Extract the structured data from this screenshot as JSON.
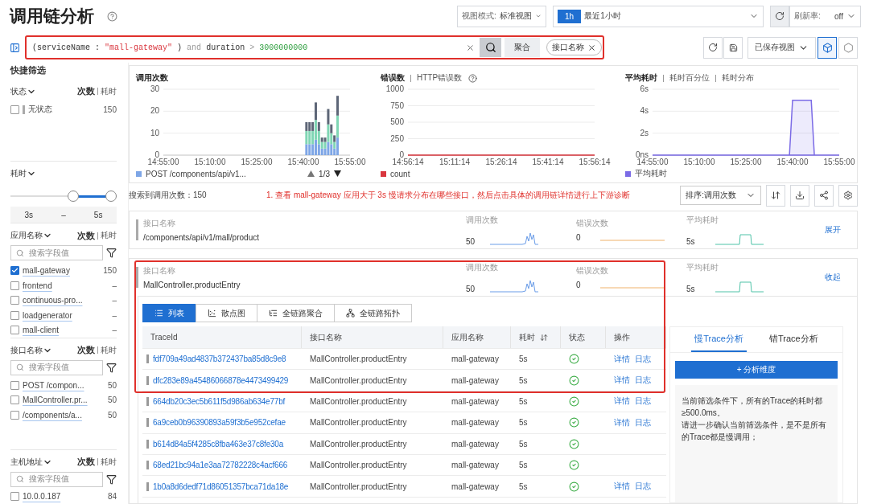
{
  "page": {
    "title": "调用链分析"
  },
  "toolbar": {
    "view_mode": {
      "label": "视图模式:",
      "value": "标准视图"
    },
    "time_range": {
      "badge": "1h",
      "value": "最近1小时"
    },
    "refresh_rate": {
      "label": "刷新率:",
      "value": "off"
    }
  },
  "query": {
    "highlighted": true,
    "tokens": [
      {
        "text": "(serviceName :",
        "kind": "plain"
      },
      {
        "text": "\"mall-gateway\"",
        "kind": "string"
      },
      {
        "text": ")",
        "kind": "plain"
      },
      {
        "text": "and",
        "kind": "keyword"
      },
      {
        "text": "duration",
        "kind": "plain"
      },
      {
        "text": ">",
        "kind": "keyword"
      },
      {
        "text": "3000000000",
        "kind": "number"
      }
    ],
    "group_label": "聚合",
    "group_tags": [
      "接口名称"
    ]
  },
  "saved_views": {
    "label": "已保存视图"
  },
  "view_toggle": [
    {
      "selected": true
    },
    {
      "selected": false
    }
  ],
  "sidebar": {
    "title": "快捷筛选",
    "sections": [
      {
        "kind": "status",
        "title": "状态",
        "metric_tabs": [
          {
            "label": "次数",
            "selected": true
          },
          {
            "label": "耗时",
            "selected": false
          }
        ],
        "items": [
          {
            "label": "无状态",
            "count": "150",
            "checked": false
          }
        ]
      },
      {
        "kind": "range",
        "title": "耗时",
        "labels": [
          "3s",
          "–",
          "5s"
        ],
        "thumbs": [
          {
            "level": 0.6
          },
          {
            "level": 1
          }
        ]
      },
      {
        "kind": "search",
        "title": "应用名称",
        "metric_tabs": [
          {
            "label": "次数",
            "selected": true
          },
          {
            "label": "耗时",
            "selected": false
          }
        ],
        "placeholder": "搜索字段值",
        "items": [
          {
            "label": "mall-gateway",
            "count": "150",
            "checked": true
          },
          {
            "label": "frontend",
            "count": "–",
            "checked": false
          },
          {
            "label": "continuous-pro...",
            "count": "–",
            "checked": false
          },
          {
            "label": "loadgenerator",
            "count": "–",
            "checked": false
          },
          {
            "label": "mall-client",
            "count": "–",
            "checked": false
          }
        ]
      },
      {
        "kind": "search",
        "title": "接口名称",
        "metric_tabs": [
          {
            "label": "次数",
            "selected": true
          },
          {
            "label": "耗时",
            "selected": false
          }
        ],
        "placeholder": "搜索字段值",
        "items": [
          {
            "label": "POST /compon...",
            "count": "50",
            "checked": false
          },
          {
            "label": "MallController.pr...",
            "count": "50",
            "checked": false
          },
          {
            "label": "/components/a...",
            "count": "50",
            "checked": false
          }
        ]
      },
      {
        "kind": "search",
        "title": "主机地址",
        "metric_tabs": [
          {
            "label": "次数",
            "selected": true
          },
          {
            "label": "耗时",
            "selected": false
          }
        ],
        "placeholder": "搜索字段值",
        "items": [
          {
            "label": "10.0.0.187",
            "count": "84",
            "checked": false
          }
        ]
      }
    ]
  },
  "charts": [
    {
      "tabs": [
        {
          "label": "调用次数",
          "selected": true
        }
      ],
      "pager": "1/3",
      "chart_data": {
        "type": "bar",
        "stacked": true,
        "grid": true,
        "ylim": [
          0,
          30
        ],
        "yticks": [
          0,
          10,
          20,
          30
        ],
        "categories": [
          "14:55:00",
          null,
          null,
          null,
          null,
          null,
          null,
          null,
          null,
          null,
          null,
          null,
          null,
          null,
          null,
          "15:10:00",
          null,
          null,
          null,
          null,
          null,
          null,
          null,
          null,
          null,
          null,
          null,
          null,
          null,
          null,
          "15:25:00",
          null,
          null,
          null,
          null,
          null,
          null,
          null,
          null,
          null,
          null,
          null,
          null,
          null,
          null,
          "15:40:00",
          null,
          null,
          null,
          null,
          null,
          null,
          null,
          null,
          null,
          null,
          null,
          null,
          null,
          null,
          "15:55:00"
        ],
        "series": [
          {
            "name": "POST /components/api/v1...",
            "color": "#7ea6e6",
            "values": [
              null,
              null,
              null,
              null,
              null,
              null,
              null,
              null,
              null,
              null,
              null,
              null,
              null,
              null,
              null,
              null,
              null,
              null,
              null,
              null,
              null,
              null,
              null,
              null,
              null,
              null,
              null,
              null,
              null,
              null,
              null,
              null,
              null,
              null,
              null,
              null,
              null,
              null,
              null,
              null,
              null,
              null,
              null,
              null,
              null,
              null,
              5,
              5,
              5,
              7,
              5,
              3,
              3,
              6,
              5,
              3,
              8,
              null,
              null,
              null,
              null
            ]
          },
          {
            "color": "#7fd6b4",
            "values": [
              null,
              null,
              null,
              null,
              null,
              null,
              null,
              null,
              null,
              null,
              null,
              null,
              null,
              null,
              null,
              null,
              null,
              null,
              null,
              null,
              null,
              null,
              null,
              null,
              null,
              null,
              null,
              null,
              null,
              null,
              null,
              null,
              null,
              null,
              null,
              null,
              null,
              null,
              null,
              null,
              null,
              null,
              null,
              null,
              null,
              null,
              6,
              6,
              6,
              9,
              6,
              3,
              3,
              8,
              5,
              3,
              10,
              null,
              null,
              null,
              null
            ]
          },
          {
            "color": "#5d6677",
            "values": [
              null,
              null,
              null,
              null,
              null,
              null,
              null,
              null,
              null,
              null,
              null,
              null,
              null,
              null,
              null,
              null,
              null,
              null,
              null,
              null,
              null,
              null,
              null,
              null,
              null,
              null,
              null,
              null,
              null,
              null,
              null,
              null,
              null,
              null,
              null,
              null,
              null,
              null,
              null,
              null,
              null,
              null,
              null,
              null,
              null,
              null,
              4,
              4,
              4,
              8,
              4,
              2,
              2,
              7,
              4,
              3,
              9,
              null,
              null,
              null,
              null
            ]
          }
        ]
      }
    },
    {
      "tabs": [
        {
          "label": "错误数",
          "selected": true
        },
        {
          "label": "HTTP错误数",
          "selected": false
        }
      ],
      "help": true,
      "chart_data": {
        "type": "line",
        "grid": true,
        "ylim": [
          0,
          1000
        ],
        "yticks": [
          0,
          250,
          500,
          750,
          1000
        ],
        "categories": [
          "14:56:14",
          "15:11:14",
          "15:26:14",
          "15:41:14",
          "15:56:14"
        ],
        "series": [
          {
            "name": "count",
            "color": "#d9363e",
            "values": [
              0,
              0,
              0,
              0,
              0
            ]
          }
        ]
      }
    },
    {
      "tabs": [
        {
          "label": "平均耗时",
          "selected": true
        },
        {
          "label": "耗时百分位",
          "selected": false
        },
        {
          "label": "耗时分布",
          "selected": false
        }
      ],
      "chart_data": {
        "type": "area",
        "grid": true,
        "ylim": [
          0,
          6
        ],
        "yticks": [
          {
            "value": 0,
            "label": "0ns"
          },
          {
            "value": 2,
            "label": "2s"
          },
          {
            "value": 4,
            "label": "4s"
          },
          {
            "value": 6,
            "label": "6s"
          }
        ],
        "categories": [
          "14:55:00",
          null,
          null,
          null,
          null,
          null,
          null,
          null,
          null,
          null,
          null,
          null,
          null,
          null,
          null,
          "15:10:00",
          null,
          null,
          null,
          null,
          null,
          null,
          null,
          null,
          null,
          null,
          null,
          null,
          null,
          null,
          "15:25:00",
          null,
          null,
          null,
          null,
          null,
          null,
          null,
          null,
          null,
          null,
          null,
          null,
          null,
          null,
          "15:40:00",
          null,
          null,
          null,
          null,
          null,
          null,
          null,
          null,
          null,
          null,
          null,
          null,
          null,
          null,
          "15:55:00"
        ],
        "series": [
          {
            "name": "平均耗时",
            "color": "#7b6be6",
            "values": [
              0,
              0,
              0,
              0,
              0,
              0,
              0,
              0,
              0,
              0,
              0,
              0,
              0,
              0,
              0,
              0,
              0,
              0,
              0,
              0,
              0,
              0,
              0,
              0,
              0,
              0,
              0,
              0,
              0,
              0,
              0,
              0,
              0,
              0,
              0,
              0,
              0,
              0,
              0,
              0,
              0,
              0,
              0,
              0,
              0,
              5,
              5,
              5,
              5,
              5,
              5,
              5,
              0,
              0,
              0,
              0,
              0,
              0,
              0,
              0,
              0
            ]
          }
        ]
      }
    }
  ],
  "summary": "搜索到调用次数：150",
  "annotation": "1. 查看 mall-gateway 应用大于 3s 慢请求分布在哪些接口，然后点击具体的调用链详情进行上下游诊断",
  "sort": {
    "label": "排序:调用次数"
  },
  "groups": [
    {
      "label": "接口名称",
      "name": "/components/api/v1/mall/product",
      "expanded": false,
      "highlighted": false,
      "toggle": "展开",
      "stats": [
        {
          "label": "调用次数",
          "value": "50",
          "kind": "spike"
        },
        {
          "label": "错误次数",
          "value": "0",
          "kind": "flat"
        },
        {
          "label": "平均耗时",
          "value": "5s",
          "kind": "pulse"
        }
      ]
    },
    {
      "label": "接口名称",
      "name": "MallController.productEntry",
      "expanded": true,
      "highlighted": true,
      "toggle": "收起",
      "stats": [
        {
          "label": "调用次数",
          "value": "50",
          "kind": "spike"
        },
        {
          "label": "错误次数",
          "value": "0",
          "kind": "flat"
        },
        {
          "label": "平均耗时",
          "value": "5s",
          "kind": "pulse"
        }
      ]
    }
  ],
  "view_tabs": [
    {
      "label": "列表",
      "selected": true
    },
    {
      "label": "散点图",
      "selected": false
    },
    {
      "label": "全链路聚合",
      "selected": false
    },
    {
      "label": "全链路拓扑",
      "selected": false
    }
  ],
  "table": {
    "columns": [
      {
        "label": "TraceId"
      },
      {
        "label": "接口名称"
      },
      {
        "label": "应用名称"
      },
      {
        "label": "耗时",
        "sortable": true
      },
      {
        "label": "状态"
      },
      {
        "label": "操作"
      }
    ],
    "rows": [
      {
        "trace": "fdf709a49ad4837b372437ba85d8c9e8",
        "api": "MallController.productEntry",
        "app": "mall-gateway",
        "duration": "5s",
        "success": true,
        "actions": [
          "详情",
          "日志"
        ]
      },
      {
        "trace": "dfc283e89a45486066878e4473499429",
        "api": "MallController.productEntry",
        "app": "mall-gateway",
        "duration": "5s",
        "success": true,
        "actions": [
          "详情",
          "日志"
        ]
      },
      {
        "trace": "664db20c3ec5b611f5d986ab634e77bf",
        "api": "MallController.productEntry",
        "app": "mall-gateway",
        "duration": "5s",
        "success": true,
        "actions": [
          "详情",
          "日志"
        ]
      },
      {
        "trace": "6a9ceb0b96390893a59f3b5e952cefae",
        "api": "MallController.productEntry",
        "app": "mall-gateway",
        "duration": "5s",
        "success": true,
        "actions": [
          "详情",
          "日志"
        ]
      },
      {
        "trace": "b614d84a5f4285c8fba463e37c8fe30a",
        "api": "MallController.productEntry",
        "app": "mall-gateway",
        "duration": "5s",
        "success": true
      },
      {
        "trace": "68ed21bc94a1e3aa72782228c4acf666",
        "api": "MallController.productEntry",
        "app": "mall-gateway",
        "duration": "5s",
        "success": true
      },
      {
        "trace": "1b0a8d6dedf71d86051357bca71da18e",
        "api": "MallController.productEntry",
        "app": "mall-gateway",
        "duration": "5s",
        "success": true,
        "actions": [
          "详情",
          "日志"
        ]
      }
    ]
  },
  "analysis": {
    "tabs": [
      {
        "label": "慢Trace分析",
        "selected": true
      },
      {
        "label": "错Trace分析",
        "selected": false
      }
    ],
    "button": "+ 分析维度",
    "paragraphs": [
      "当前筛选条件下，所有的Trace的耗时都≥500.0ms。",
      "请进一步确认当前筛选条件，是不是所有的Trace都是慢调用；"
    ]
  }
}
